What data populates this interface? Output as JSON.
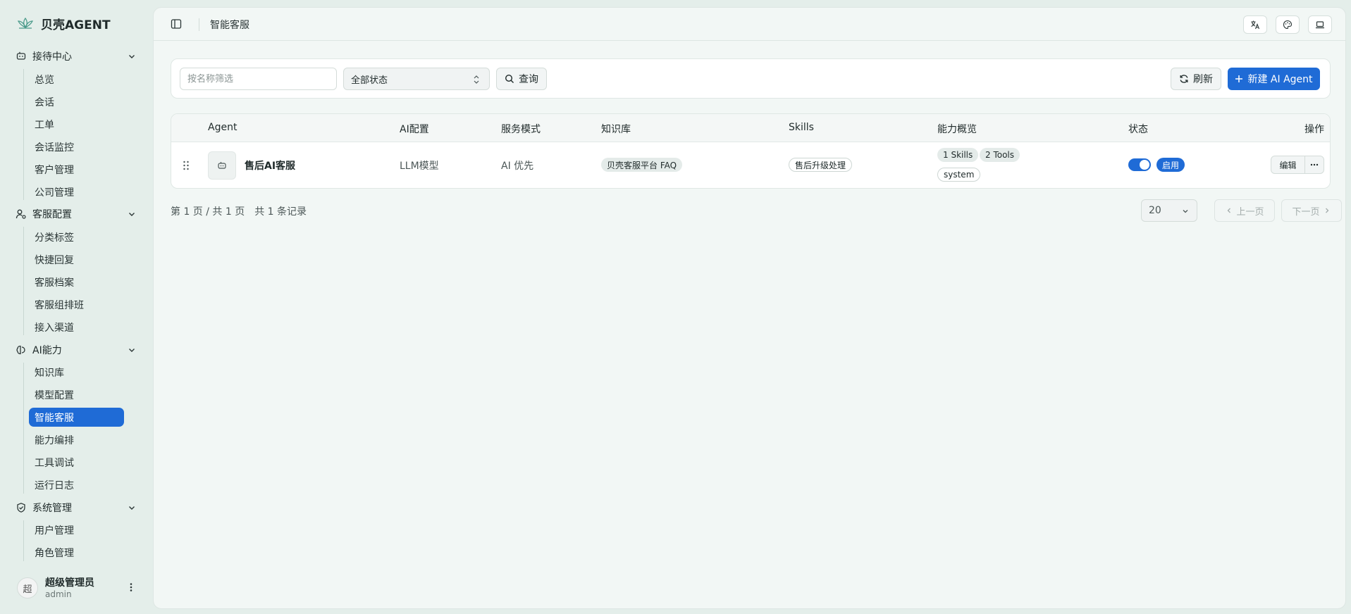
{
  "brand": {
    "name": "贝壳AGENT"
  },
  "sidebar": {
    "groups": [
      {
        "label": "接待中心",
        "items": [
          "总览",
          "会话",
          "工单",
          "会话监控",
          "客户管理",
          "公司管理"
        ]
      },
      {
        "label": "客服配置",
        "items": [
          "分类标签",
          "快捷回复",
          "客服档案",
          "客服组排班",
          "接入渠道"
        ]
      },
      {
        "label": "AI能力",
        "items": [
          "知识库",
          "模型配置",
          "智能客服",
          "能力编排",
          "工具调试",
          "运行日志"
        ]
      },
      {
        "label": "系统管理",
        "items": [
          "用户管理",
          "角色管理"
        ]
      }
    ],
    "active_item": "智能客服"
  },
  "user": {
    "avatar_text": "超",
    "name": "超级管理员",
    "account": "admin"
  },
  "topbar": {
    "breadcrumb": "智能客服"
  },
  "filters": {
    "search_placeholder": "按名称筛选",
    "status_value": "全部状态",
    "query_label": "查询",
    "refresh_label": "刷新",
    "new_label": "新建 AI Agent"
  },
  "table": {
    "columns": [
      "Agent",
      "AI配置",
      "服务模式",
      "知识库",
      "Skills",
      "能力概览",
      "状态",
      "操作"
    ],
    "rows": [
      {
        "agent": "售后AI客服",
        "ai_config": "LLM模型",
        "service_mode": "AI 优先",
        "knowledge_base": "贝壳客服平台 FAQ",
        "skills": "售后升级处理",
        "capabilities": [
          "1 Skills",
          "2 Tools",
          "system"
        ],
        "enabled": true,
        "status": "启用",
        "edit_label": "编辑"
      }
    ]
  },
  "pagination": {
    "summary": "第 1 页 / 共 1 页　共 1 条记录",
    "page_size": "20",
    "prev_label": "上一页",
    "next_label": "下一页"
  },
  "colors": {
    "accent": "#1f6bd6",
    "background": "#e4eeea",
    "panel": "#f2f7f5"
  }
}
